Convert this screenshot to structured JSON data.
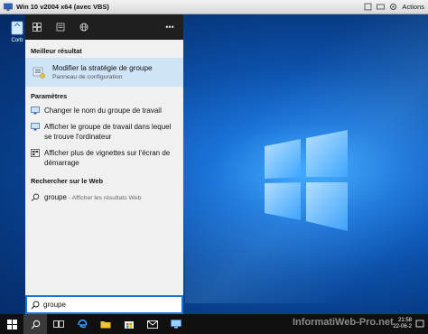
{
  "vm": {
    "title": "Win 10 v2004 x64 (avec VBS)",
    "actions_label": "Actions"
  },
  "desktop": {
    "icon_label": "Corb"
  },
  "search_panel": {
    "best_match_header": "Meilleur résultat",
    "best_match": {
      "title": "Modifier la stratégie de groupe",
      "subtitle": "Panneau de configuration"
    },
    "settings_header": "Paramètres",
    "settings": [
      {
        "text": "Changer le nom du groupe de travail",
        "icon": "monitor-icon"
      },
      {
        "text": "Afficher le groupe de travail dans lequel se trouve l'ordinateur",
        "icon": "monitor-icon"
      },
      {
        "text": "Afficher plus de vignettes sur l'écran de démarrage",
        "icon": "tiles-icon"
      }
    ],
    "web_header": "Rechercher sur le Web",
    "web_result": {
      "query": "groupe",
      "sub": " - Afficher les résultats Web"
    },
    "search_value": "groupe"
  },
  "taskbar": {
    "time": "21:58",
    "date": "22-06-2"
  },
  "watermark": "InformatiWeb-Pro.net",
  "colors": {
    "accent": "#1a73d8",
    "selection": "#cfe4f7",
    "panel_bg": "#f0f0f0",
    "taskbar": "#101010"
  }
}
